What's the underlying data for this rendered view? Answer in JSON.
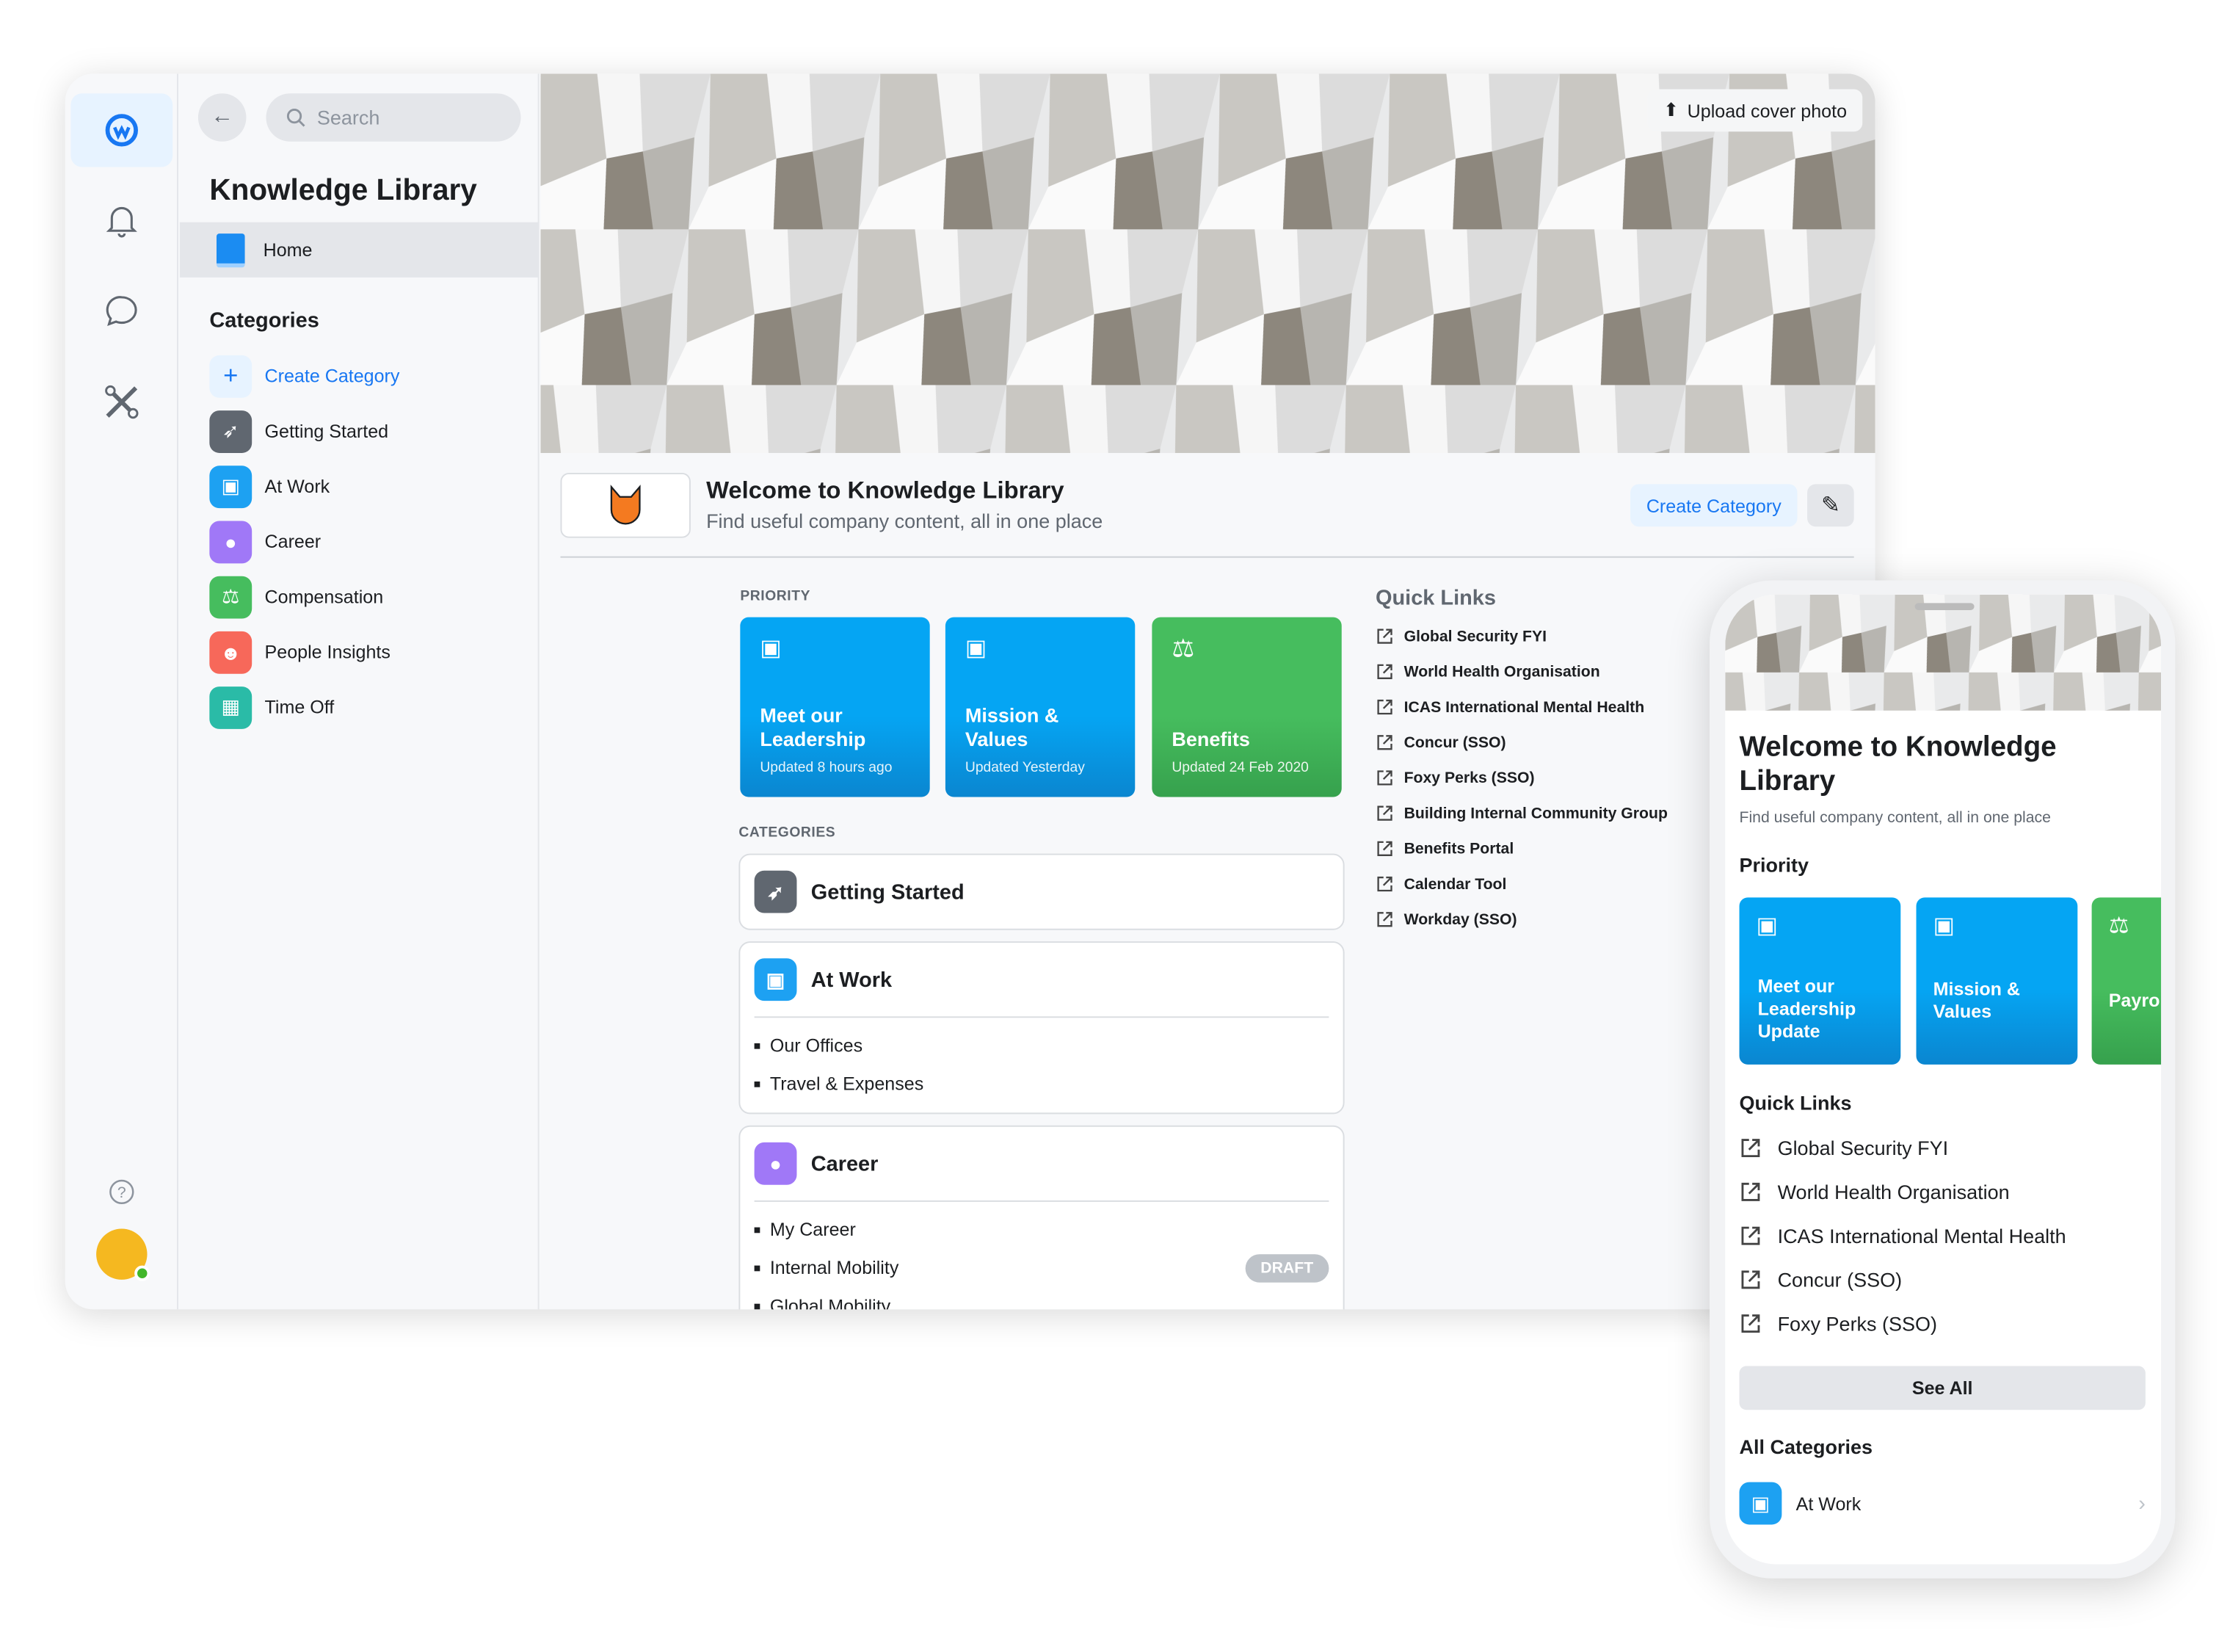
{
  "colors": {
    "accent": "#1877f2",
    "blue_card": "#05a5f3",
    "green_card": "#46bd5e",
    "getting_started": "#606770",
    "at_work": "#1da1f2",
    "career": "#a078f7",
    "compensation": "#46bd5e",
    "people_insights": "#f7685a",
    "time_off": "#2abba7"
  },
  "rail": {
    "icons": [
      "workplace-logo-icon",
      "bell-icon",
      "chat-bubble-icon",
      "tools-icon",
      "help-icon",
      "avatar"
    ]
  },
  "sidebar": {
    "search_placeholder": "Search",
    "title": "Knowledge Library",
    "home": "Home",
    "categories_heading": "Categories",
    "create_category": "Create Category",
    "items": [
      {
        "label": "Getting Started",
        "icon": "rocket-icon",
        "color": "#606770"
      },
      {
        "label": "At Work",
        "icon": "briefcase-icon",
        "color": "#1da1f2"
      },
      {
        "label": "Career",
        "icon": "career-icon",
        "color": "#a078f7"
      },
      {
        "label": "Compensation",
        "icon": "scales-icon",
        "color": "#46bd5e"
      },
      {
        "label": "People Insights",
        "icon": "people-icon",
        "color": "#f7685a"
      },
      {
        "label": "Time Off",
        "icon": "calendar-icon",
        "color": "#2abba7"
      }
    ]
  },
  "main": {
    "upload_cover": "Upload cover photo",
    "welcome_title": "Welcome to Knowledge Library",
    "welcome_sub": "Find useful company content, all in one place",
    "create_category": "Create Category",
    "priority_label": "PRIORITY",
    "priority": [
      {
        "title": "Meet our Leadership",
        "updated": "Updated 8 hours ago",
        "icon": "briefcase-icon"
      },
      {
        "title": "Mission & Values",
        "updated": "Updated Yesterday",
        "icon": "briefcase-icon"
      },
      {
        "title": "Benefits",
        "updated": "Updated 24 Feb 2020",
        "icon": "scales-icon"
      }
    ],
    "categories_label": "CATEGORIES",
    "categories": [
      {
        "title": "Getting Started",
        "items": []
      },
      {
        "title": "At Work",
        "items": [
          "Our Offices",
          "Travel & Expenses"
        ]
      },
      {
        "title": "Career",
        "items": [
          "My Career",
          "Internal Mobility",
          "Global Mobility"
        ],
        "draft_label": "DRAFT"
      }
    ],
    "quick_links_heading": "Quick Links",
    "quick_links": [
      "Global Security FYI",
      "World Health Organisation",
      "ICAS International Mental Health",
      "Concur (SSO)",
      "Foxy Perks (SSO)",
      "Building Internal Community Group",
      "Benefits Portal",
      "Calendar Tool",
      "Workday (SSO)"
    ]
  },
  "phone": {
    "title": "Welcome to Knowledge Library",
    "subtitle": "Find useful company content, all in one place",
    "priority_heading": "Priority",
    "priority": [
      "Meet our Leadership Update",
      "Mission & Values",
      "Payro"
    ],
    "quick_links_heading": "Quick Links",
    "quick_links": [
      "Global Security FYI",
      "World Health Organisation",
      "ICAS International Mental Health",
      "Concur (SSO)",
      "Foxy Perks (SSO)"
    ],
    "see_all": "See All",
    "all_categories_heading": "All Categories",
    "categories": [
      "At Work"
    ]
  }
}
